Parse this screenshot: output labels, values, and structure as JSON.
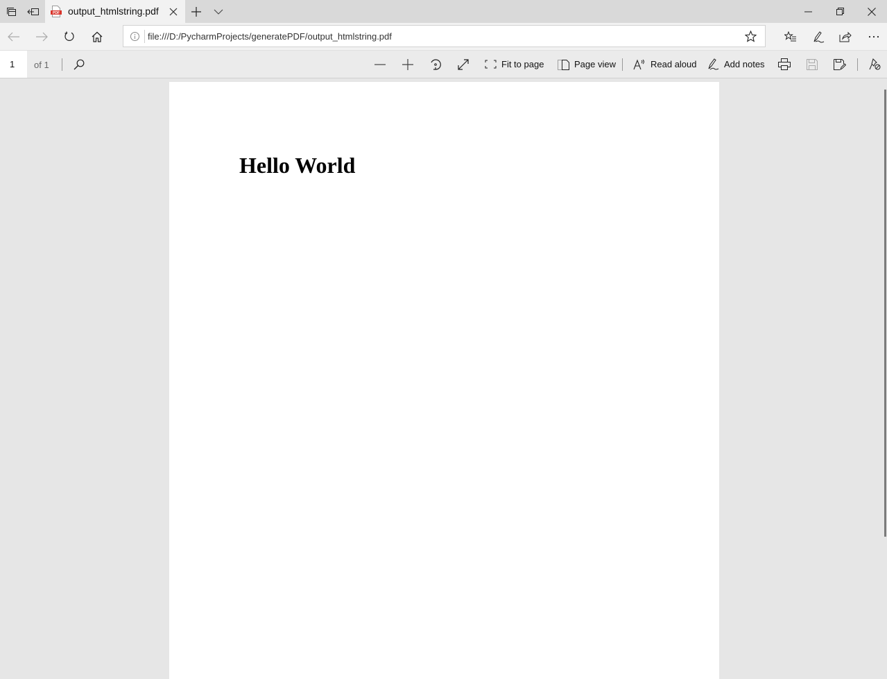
{
  "tabstrip": {
    "tab": {
      "title": "output_htmlstring.pdf",
      "icon": "pdf-file-icon"
    },
    "buttons": [
      "tab-overview-icon",
      "set-aside-tabs-icon",
      "new-tab-icon",
      "tab-preview-chevron-icon"
    ],
    "window_controls": [
      "minimize-icon",
      "restore-icon",
      "close-icon"
    ]
  },
  "navbar": {
    "url": "file:///D:/PycharmProjects/generatePDF/output_htmlstring.pdf",
    "buttons": [
      "back",
      "forward",
      "refresh",
      "home",
      "favorites",
      "add-notes",
      "share",
      "more"
    ]
  },
  "pdf_toolbar": {
    "page_current": "1",
    "page_total_label": "of 1",
    "fit_to_page": "Fit to page",
    "page_view": "Page view",
    "read_aloud": "Read aloud",
    "add_notes": "Add notes"
  },
  "document": {
    "heading": "Hello World"
  },
  "colors": {
    "tabstrip_bg": "#d9d9d9",
    "toolbar_bg": "#f2f2f2",
    "viewer_bg": "#e6e6e6",
    "pdf_icon_red": "#d9342b"
  }
}
